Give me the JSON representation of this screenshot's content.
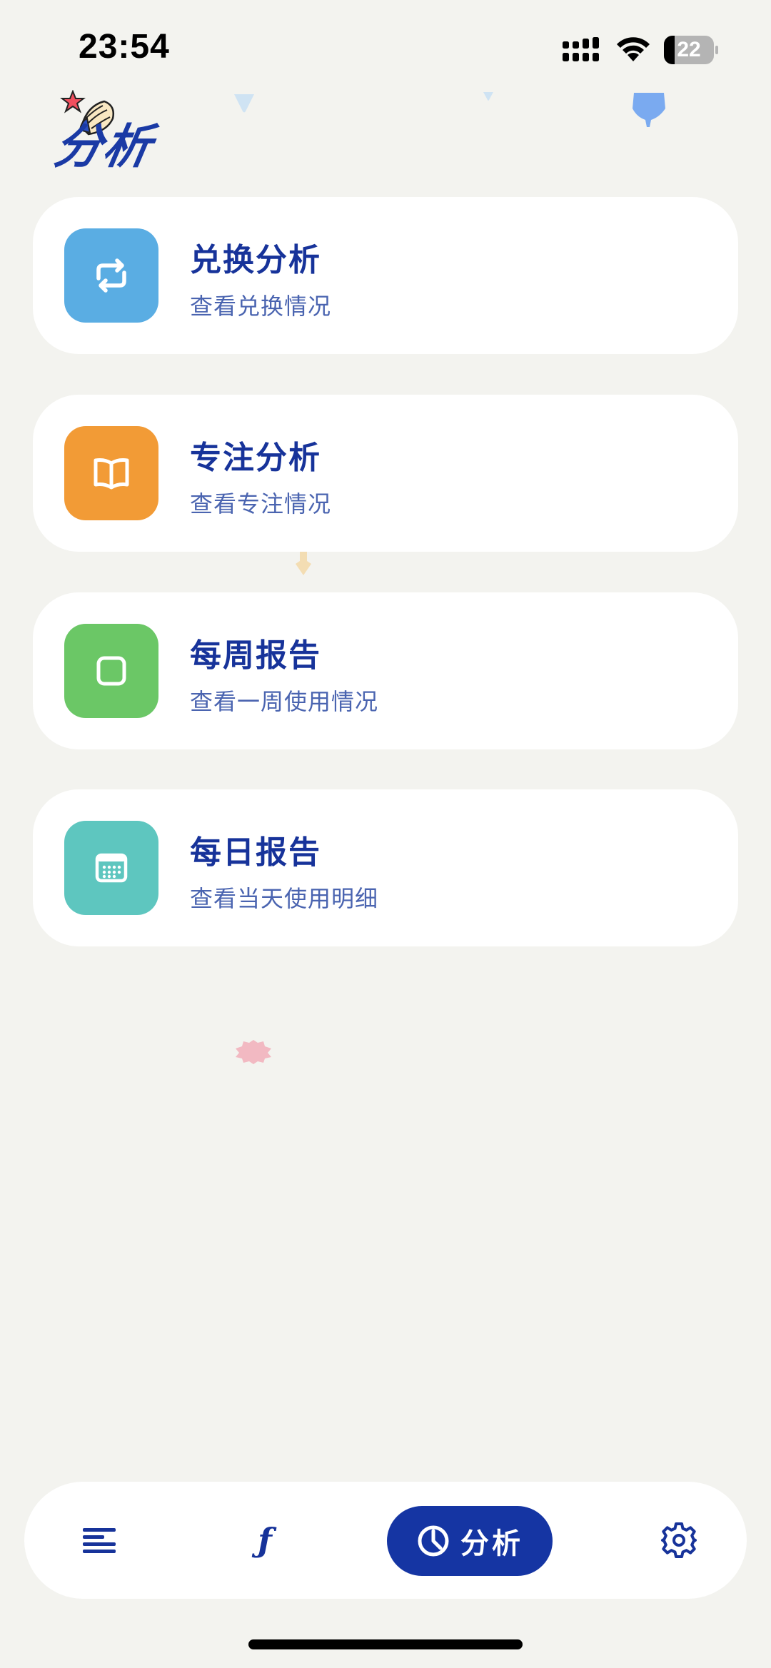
{
  "status_bar": {
    "time": "23:54",
    "battery": "22",
    "battery_level": 0.22
  },
  "header": {
    "title": "分析"
  },
  "cards": [
    {
      "title": "兑换分析",
      "subtitle": "查看兑换情况",
      "color": "#5aade3",
      "icon": "exchange-icon"
    },
    {
      "title": "专注分析",
      "subtitle": "查看专注情况",
      "color": "#f29b36",
      "icon": "book-icon"
    },
    {
      "title": "每周报告",
      "subtitle": "查看一周使用情况",
      "color": "#6bc766",
      "icon": "square-icon"
    },
    {
      "title": "每日报告",
      "subtitle": "查看当天使用明细",
      "color": "#5ec6bf",
      "icon": "calendar-icon"
    }
  ],
  "tab_bar": {
    "items": [
      {
        "icon": "list-icon"
      },
      {
        "icon": "function-icon",
        "glyph": "ƒ"
      },
      {
        "icon": "pie-chart-icon",
        "label": "分析",
        "active": true
      },
      {
        "icon": "gear-icon"
      }
    ]
  },
  "colors": {
    "accent": "#1535a3",
    "background": "#f3f3ef"
  }
}
